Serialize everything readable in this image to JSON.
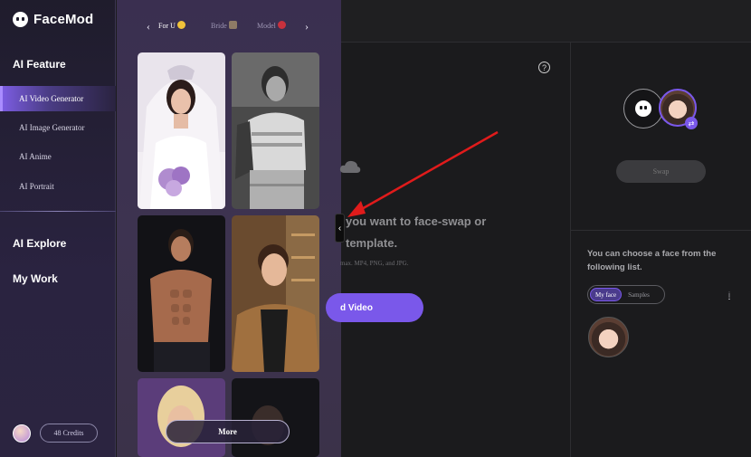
{
  "app": {
    "name": "FaceMod"
  },
  "sidebar": {
    "feature_title": "AI Feature",
    "items": [
      {
        "label": "AI Video Generator",
        "active": true
      },
      {
        "label": "AI Image Generator",
        "active": false
      },
      {
        "label": "AI Anime",
        "active": false
      },
      {
        "label": "AI Portrait",
        "active": false
      }
    ],
    "explore_title": "AI Explore",
    "mywork_title": "My Work",
    "credits_label": "48 Credits"
  },
  "templates": {
    "categories": [
      {
        "label": "For U",
        "active": true
      },
      {
        "label": "Bride",
        "active": false
      },
      {
        "label": "Model",
        "active": false
      }
    ],
    "more_label": "More"
  },
  "main": {
    "headline_line1": "you want to face-swap or",
    "headline_line2": "template.",
    "note": "max. MP4, PNG, and JPG.",
    "upload_label": "d Video",
    "help_label": "?"
  },
  "faces": {
    "swap_label": "Swap",
    "choose_text": "You can choose a face from the following list.",
    "tabs": [
      {
        "label": "My face",
        "active": true
      },
      {
        "label": "Samples",
        "active": false
      }
    ],
    "info_label": "i"
  },
  "colors": {
    "accent": "#7a58ea",
    "panel_bg": "#3a2f50",
    "annotation_arrow": "#e01b1b"
  }
}
